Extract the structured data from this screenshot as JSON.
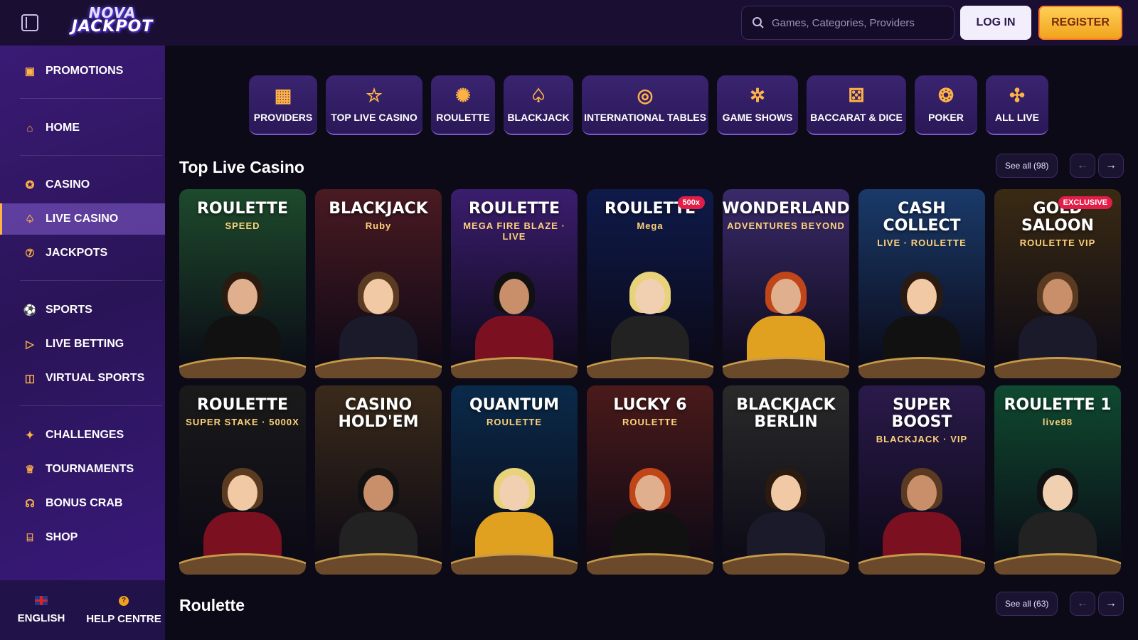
{
  "header": {
    "logo_line1": "NOVA",
    "logo_line2": "JACKPOT",
    "search_placeholder": "Games, Categories, Providers",
    "login_label": "LOG IN",
    "register_label": "REGISTER"
  },
  "sidebar": {
    "items": [
      {
        "label": "PROMOTIONS",
        "icon": "gift-icon"
      },
      {
        "label": "HOME",
        "icon": "home-icon"
      },
      {
        "label": "CASINO",
        "icon": "casino-chip-icon"
      },
      {
        "label": "LIVE CASINO",
        "icon": "live-casino-icon",
        "active": true
      },
      {
        "label": "JACKPOTS",
        "icon": "jackpot-7-icon"
      },
      {
        "label": "SPORTS",
        "icon": "soccer-ball-icon"
      },
      {
        "label": "LIVE BETTING",
        "icon": "play-icon"
      },
      {
        "label": "VIRTUAL SPORTS",
        "icon": "gamepad-icon"
      },
      {
        "label": "CHALLENGES",
        "icon": "challenge-icon"
      },
      {
        "label": "TOURNAMENTS",
        "icon": "trophy-icon"
      },
      {
        "label": "BONUS CRAB",
        "icon": "crab-icon"
      },
      {
        "label": "SHOP",
        "icon": "shop-icon"
      }
    ],
    "footer": {
      "language_label": "ENGLISH",
      "help_label": "HELP CENTRE"
    }
  },
  "categories": [
    {
      "label": "PROVIDERS",
      "icon": "grid-icon"
    },
    {
      "label": "TOP LIVE CASINO",
      "icon": "star-icon"
    },
    {
      "label": "ROULETTE",
      "icon": "roulette-icon"
    },
    {
      "label": "BLACKJACK",
      "icon": "spade-icon"
    },
    {
      "label": "INTERNATIONAL TABLES",
      "icon": "globe-icon"
    },
    {
      "label": "GAME SHOWS",
      "icon": "wheel-icon"
    },
    {
      "label": "BACCARAT & DICE",
      "icon": "dice-icon"
    },
    {
      "label": "POKER",
      "icon": "poker-chip-icon"
    },
    {
      "label": "ALL LIVE",
      "icon": "all-live-icon"
    }
  ],
  "sections": {
    "top_live": {
      "title": "Top Live Casino",
      "see_all": "See all (98)"
    },
    "roulette": {
      "title": "Roulette",
      "see_all": "See all (63)"
    }
  },
  "games_row1": [
    {
      "title": "ROULETTE",
      "sub": "SPEED",
      "bg": "#1d4a2c"
    },
    {
      "title": "BLACKJACK",
      "sub": "Ruby",
      "bg": "#4a1a22"
    },
    {
      "title": "ROULETTE",
      "sub": "MEGA FIRE BLAZE · LIVE",
      "bg": "#3b1d6e"
    },
    {
      "title": "ROULETTE",
      "sub": "Mega",
      "badge": "500x",
      "bg": "#0f1a4a"
    },
    {
      "title": "WONDERLAND",
      "sub": "ADVENTURES BEYOND",
      "bg": "#3a2a6a"
    },
    {
      "title": "CASH COLLECT",
      "sub": "LIVE · ROULETTE",
      "bg": "#1a3a6a"
    },
    {
      "title": "GOLD SALOON",
      "sub": "ROULETTE VIP",
      "badge": "EXCLUSIVE",
      "bg": "#3a2a14"
    }
  ],
  "games_row2": [
    {
      "title": "ROULETTE",
      "sub": "SUPER STAKE · 5000X",
      "bg": "#1a1a1a"
    },
    {
      "title": "CASINO HOLD'EM",
      "sub": "",
      "bg": "#3a2a1a"
    },
    {
      "title": "QUANTUM",
      "sub": "ROULETTE",
      "bg": "#0a2a4a"
    },
    {
      "title": "LUCKY 6",
      "sub": "ROULETTE",
      "bg": "#4a1a1a"
    },
    {
      "title": "BLACKJACK BERLIN",
      "sub": "",
      "bg": "#2a2a2a"
    },
    {
      "title": "SUPER BOOST",
      "sub": "BLACKJACK · VIP",
      "bg": "#2a1a4a"
    },
    {
      "title": "ROULETTE 1",
      "sub": "live88",
      "bg": "#0f4a30"
    }
  ],
  "colors": {
    "accent": "#ffb347",
    "header_bg": "#1a0f33",
    "sidebar_bg": "#2a1457",
    "page_bg": "#0d0a18"
  }
}
